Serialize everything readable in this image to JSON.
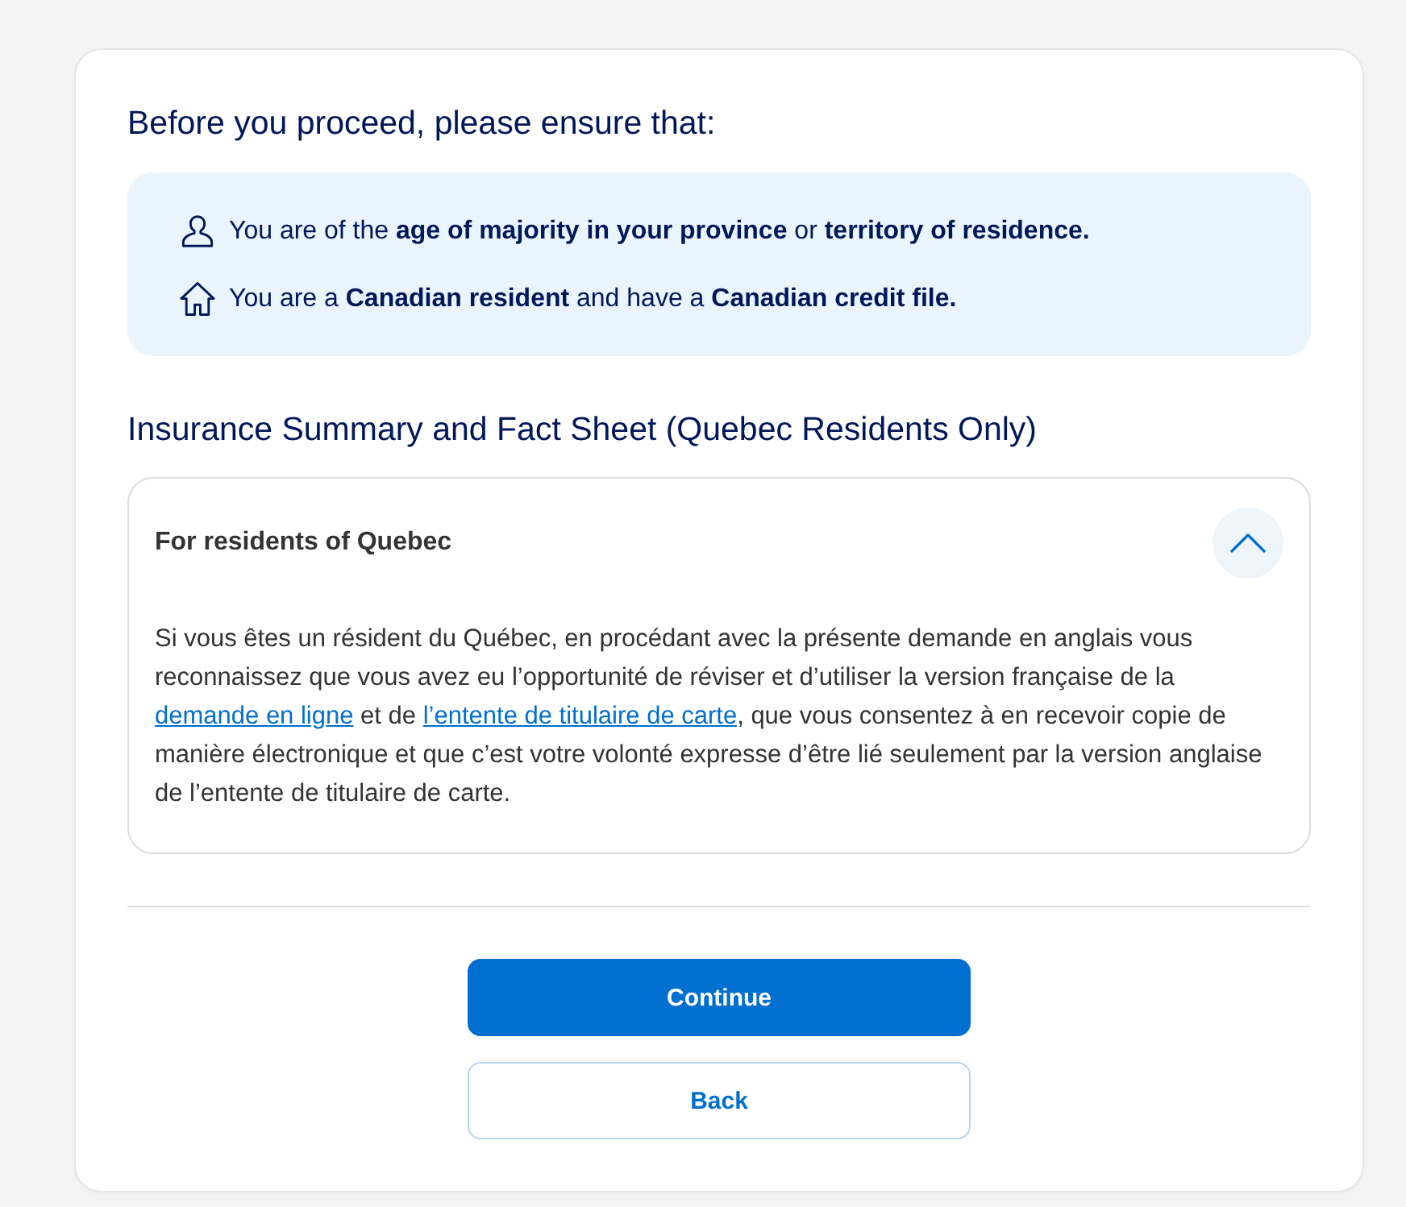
{
  "title": "Before you proceed, please ensure that:",
  "requirements": [
    {
      "kind": "person",
      "text": "You are of the **age of majority in your province** or **territory of residence.**"
    },
    {
      "kind": "home",
      "text": "You are a **Canadian resident** and have a **Canadian credit file.**"
    }
  ],
  "section_title": "Insurance Summary and Fact Sheet (Quebec Residents Only)",
  "accordion": {
    "title": "For residents of Quebec",
    "expanded": true,
    "body": [
      {
        "kind": "text",
        "text": "Si vous êtes un résident du Québec, en procédant avec la présente demande en anglais vous reconnaissez que vous avez eu l’opportunité de réviser et d’utiliser la version française de la "
      },
      {
        "kind": "link",
        "text": "demande en ligne"
      },
      {
        "kind": "text",
        "text": " et de "
      },
      {
        "kind": "link",
        "text": "l’entente de titulaire de carte"
      },
      {
        "kind": "text",
        "text": ", que vous consentez à en recevoir copie de manière électronique et que c’est votre volonté expresse d’être lié seulement par la version anglaise de l’entente de titulaire de carte."
      }
    ]
  },
  "buttons": [
    {
      "kind": "primary",
      "label": "Continue"
    },
    {
      "kind": "secondary",
      "label": "Back"
    }
  ]
}
